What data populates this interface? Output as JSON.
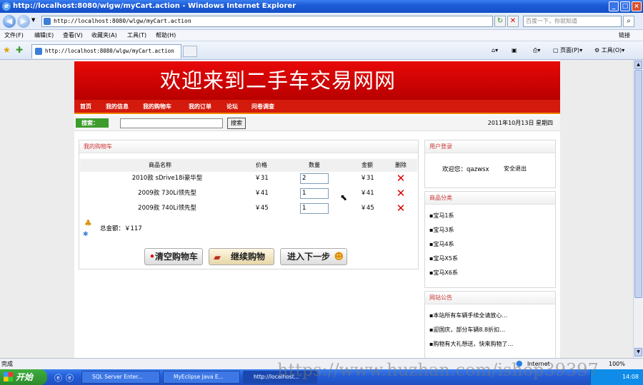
{
  "window": {
    "title": "http://localhost:8080/wlgw/myCart.action - Windows Internet Explorer"
  },
  "browser": {
    "address": "http://localhost:8080/wlgw/myCart.action",
    "search_placeholder": "百度一下，你就知道",
    "tab_title": "http://localhost:8080/wlgw/myCart.action",
    "menus": [
      "文件(F)",
      "编辑(E)",
      "查看(V)",
      "收藏夹(A)",
      "工具(T)",
      "帮助(H)"
    ],
    "menu_right": "链接",
    "tools": {
      "page": "页面(P)",
      "tools": "工具(O)"
    }
  },
  "site": {
    "banner": "欢迎来到二手车交易网网",
    "nav": [
      "首页",
      "我的信息",
      "我的购物车",
      "我的订单",
      "论坛",
      "问卷调查"
    ],
    "search_label": "搜索：",
    "search_button": "搜索",
    "date": "2011年10月13日 星期四"
  },
  "cart": {
    "title": "我的购物车",
    "headers": [
      "商品名称",
      "价格",
      "数量",
      "金额",
      "删除"
    ],
    "rows": [
      {
        "name": "2010款 sDrive18i豪华型",
        "price": "￥31",
        "qty": "2",
        "amount": "￥31"
      },
      {
        "name": "2009款 730Li领先型",
        "price": "￥41",
        "qty": "1",
        "amount": "￥41"
      },
      {
        "name": "2009款 740Li领先型",
        "price": "￥45",
        "qty": "1",
        "amount": "￥45"
      }
    ],
    "total_label": "总金额：￥117",
    "buttons": {
      "clear": "清空购物车",
      "continue": "继续购物",
      "next": "进入下一步"
    }
  },
  "sidebar": {
    "login": {
      "title": "用户登录",
      "welcome": "欢迎您：qazwsx",
      "logout": "安全退出"
    },
    "categories": {
      "title": "商品分类",
      "items": [
        "宝马1系",
        "宝马3系",
        "宝马4系",
        "宝马X5系",
        "宝马X6系"
      ]
    },
    "notices": {
      "title": "网站公告",
      "items": [
        "本站所有车辆手续全请放心…",
        "迎国庆，部分车辆8.8折扣…",
        "购物有大礼想送，快来购物了…"
      ]
    }
  },
  "status": {
    "left": "完成",
    "zone": "Internet",
    "zoom": "100%"
  },
  "taskbar": {
    "start": "开始",
    "tasks": [
      "SQL Server Enter...",
      "MyEclipse Java E...",
      "http://localhost..."
    ],
    "clock": "14:08"
  },
  "watermark": "https://www.huzhan.com/ishop39397"
}
